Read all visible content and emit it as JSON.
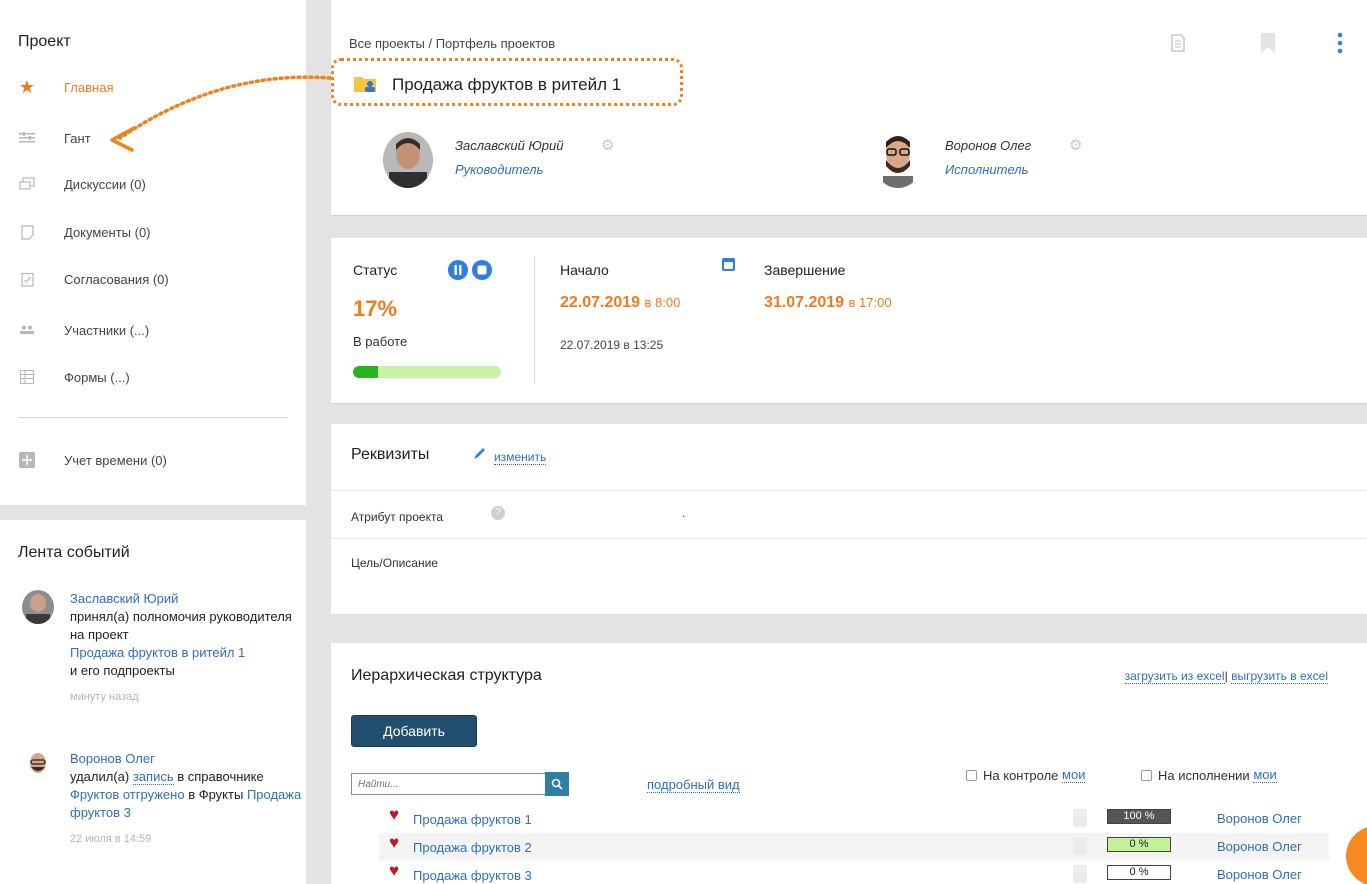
{
  "sidebar": {
    "title": "Проект",
    "items": [
      {
        "label": "Главная",
        "icon": "star-icon"
      },
      {
        "label": "Гант",
        "icon": "gantt-icon"
      },
      {
        "label": "Дискуссии (0)",
        "icon": "discussion-icon"
      },
      {
        "label": "Документы (0)",
        "icon": "document-icon"
      },
      {
        "label": "Согласования (0)",
        "icon": "approval-icon"
      },
      {
        "label": "Участники (...)",
        "icon": "participants-icon"
      },
      {
        "label": "Формы (...)",
        "icon": "forms-icon"
      },
      {
        "label": "Учет времени (0)",
        "icon": "time-tracking-icon"
      }
    ]
  },
  "feed": {
    "title": "Лента событий",
    "entries": [
      {
        "user": "Заславский Юрий",
        "action": "принял(а) полномочия руководителя на проект",
        "project": "Продажа фруктов в ритейл 1",
        "tail": "и его подпроекты",
        "time": "минуту назад"
      },
      {
        "user": "Воронов Олег",
        "action_prefix": "удалил(а)",
        "record": "запись",
        "action_mid": "в справочнике",
        "dict_link": "Фруктов отгружено",
        "in_text": "в Фрукты",
        "target": "Продажа фруктов 3",
        "time": "22 июля в 14:59"
      }
    ]
  },
  "header": {
    "breadcrumb": "Все проекты / Портфель проектов",
    "title": "Продажа фруктов в ритейл 1",
    "people": [
      {
        "name": "Заславский Юрий",
        "role": "Руководитель"
      },
      {
        "name": "Воронов Олег",
        "role": "Исполнитель"
      }
    ]
  },
  "status": {
    "label": "Статус",
    "percent": "17%",
    "progress": 0.17,
    "state": "В работе",
    "start_label": "Начало",
    "start_date": "22.07.2019",
    "start_time": "в 8:00",
    "actual_start": "22.07.2019 в 13:25",
    "end_label": "Завершение",
    "end_date": "31.07.2019",
    "end_time": "в 17:00"
  },
  "requisites": {
    "title": "Реквизиты",
    "edit": "изменить",
    "attr_label": "Атрибут проекта",
    "attr_value": ".",
    "goal_label": "Цель/Описание"
  },
  "hierarchy": {
    "title": "Иерархическая структура",
    "load_excel": "загрузить из excel",
    "separator": "|",
    "export_excel": "выгрузить в excel",
    "add_button": "Добавить",
    "search_placeholder": "Найти...",
    "detail_view": "подробный вид",
    "control_label": "На контроле",
    "control_mine": "мои",
    "exec_label": "На исполнении",
    "exec_mine": "мои",
    "rows": [
      {
        "name": "Продажа фруктов 1",
        "percent": "100 %",
        "assignee": "Воронов Олег"
      },
      {
        "name": "Продажа фруктов 2",
        "percent": "0 %",
        "assignee": "Воронов Олег"
      },
      {
        "name": "Продажа фруктов 3",
        "percent": "0 %",
        "assignee": "Воронов Олег"
      }
    ]
  },
  "colors": {
    "accent": "#f07a1f",
    "link": "#2f6fba",
    "button": "#234f6e",
    "progress_fill": "#27b423"
  }
}
